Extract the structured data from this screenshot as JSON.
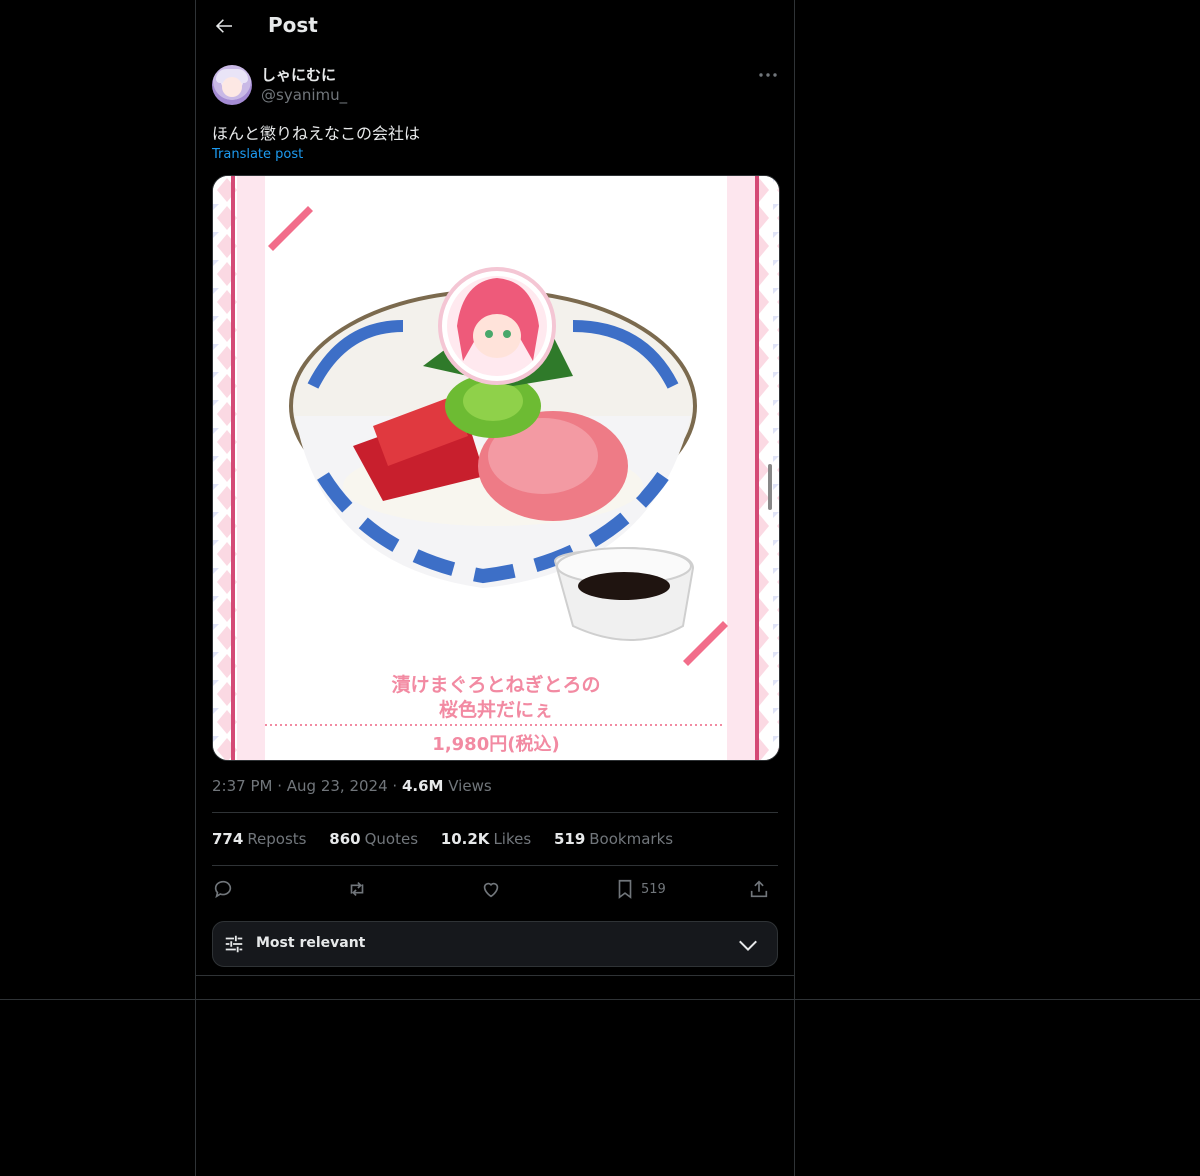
{
  "header": {
    "title": "Post"
  },
  "post": {
    "author_name": "しゃにむに",
    "author_handle": "@syanimu_",
    "text": "ほんと懲りねえなこの会社は",
    "translate_label": "Translate post",
    "image_caption_line1": "漬けまぐろとねぎとろの",
    "image_caption_line2": "桜色丼だにぇ",
    "image_price": "1,980円(税込)",
    "time": "2:37 PM",
    "date": "Aug 23, 2024",
    "views_count": "4.6M",
    "views_label": "Views"
  },
  "stats": [
    {
      "count": "774",
      "label": "Reposts"
    },
    {
      "count": "860",
      "label": "Quotes"
    },
    {
      "count": "10.2K",
      "label": "Likes"
    },
    {
      "count": "519",
      "label": "Bookmarks"
    }
  ],
  "actions": {
    "reply_icon": "reply-icon",
    "repost_icon": "repost-icon",
    "like_icon": "like-icon",
    "bookmark_icon": "bookmark-icon",
    "bookmark_count": "519",
    "share_icon": "share-icon"
  },
  "sort": {
    "label": "Most relevant"
  },
  "colors": {
    "accent": "#1d9bf0",
    "text": "#e7e9ea",
    "muted": "#71767b",
    "border": "#2f3336",
    "bg": "#000000"
  }
}
